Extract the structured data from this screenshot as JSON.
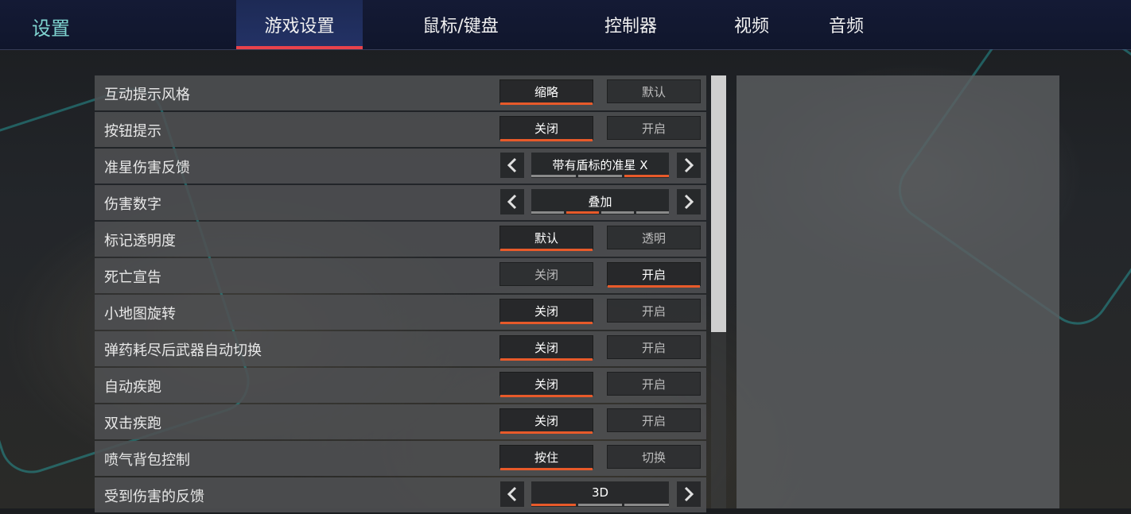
{
  "header": {
    "title": "设置",
    "tabs": [
      {
        "label": "游戏设置",
        "active": true
      },
      {
        "label": "鼠标/键盘",
        "active": false
      },
      {
        "label": "控制器",
        "active": false
      },
      {
        "label": "视频",
        "active": false
      },
      {
        "label": "音频",
        "active": false
      }
    ]
  },
  "settings": [
    {
      "label": "互动提示风格",
      "type": "toggle",
      "options": [
        "缩略",
        "默认"
      ],
      "selected": 0
    },
    {
      "label": "按钮提示",
      "type": "toggle",
      "options": [
        "关闭",
        "开启"
      ],
      "selected": 0
    },
    {
      "label": "准星伤害反馈",
      "type": "selector",
      "value": "带有盾标的准星 X",
      "step_count": 3,
      "step_selected": 3
    },
    {
      "label": "伤害数字",
      "type": "selector",
      "value": "叠加",
      "step_count": 4,
      "step_selected": 2
    },
    {
      "label": "标记透明度",
      "type": "toggle",
      "options": [
        "默认",
        "透明"
      ],
      "selected": 0
    },
    {
      "label": "死亡宣告",
      "type": "toggle",
      "options": [
        "关闭",
        "开启"
      ],
      "selected": 1
    },
    {
      "label": "小地图旋转",
      "type": "toggle",
      "options": [
        "关闭",
        "开启"
      ],
      "selected": 0
    },
    {
      "label": "弹药耗尽后武器自动切换",
      "type": "toggle",
      "options": [
        "关闭",
        "开启"
      ],
      "selected": 0
    },
    {
      "label": "自动疾跑",
      "type": "toggle",
      "options": [
        "关闭",
        "开启"
      ],
      "selected": 0
    },
    {
      "label": "双击疾跑",
      "type": "toggle",
      "options": [
        "关闭",
        "开启"
      ],
      "selected": 0
    },
    {
      "label": "喷气背包控制",
      "type": "toggle",
      "options": [
        "按住",
        "切换"
      ],
      "selected": 0
    },
    {
      "label": "受到伤害的反馈",
      "type": "selector",
      "value": "3D",
      "step_count": 3,
      "step_selected": 1
    }
  ],
  "colors": {
    "accent": "#e85a2a",
    "tab_underline": "#e8424b",
    "title": "#7fd4d0"
  },
  "icons": {
    "left_arrow": "chevron-left-icon",
    "right_arrow": "chevron-right-icon"
  }
}
